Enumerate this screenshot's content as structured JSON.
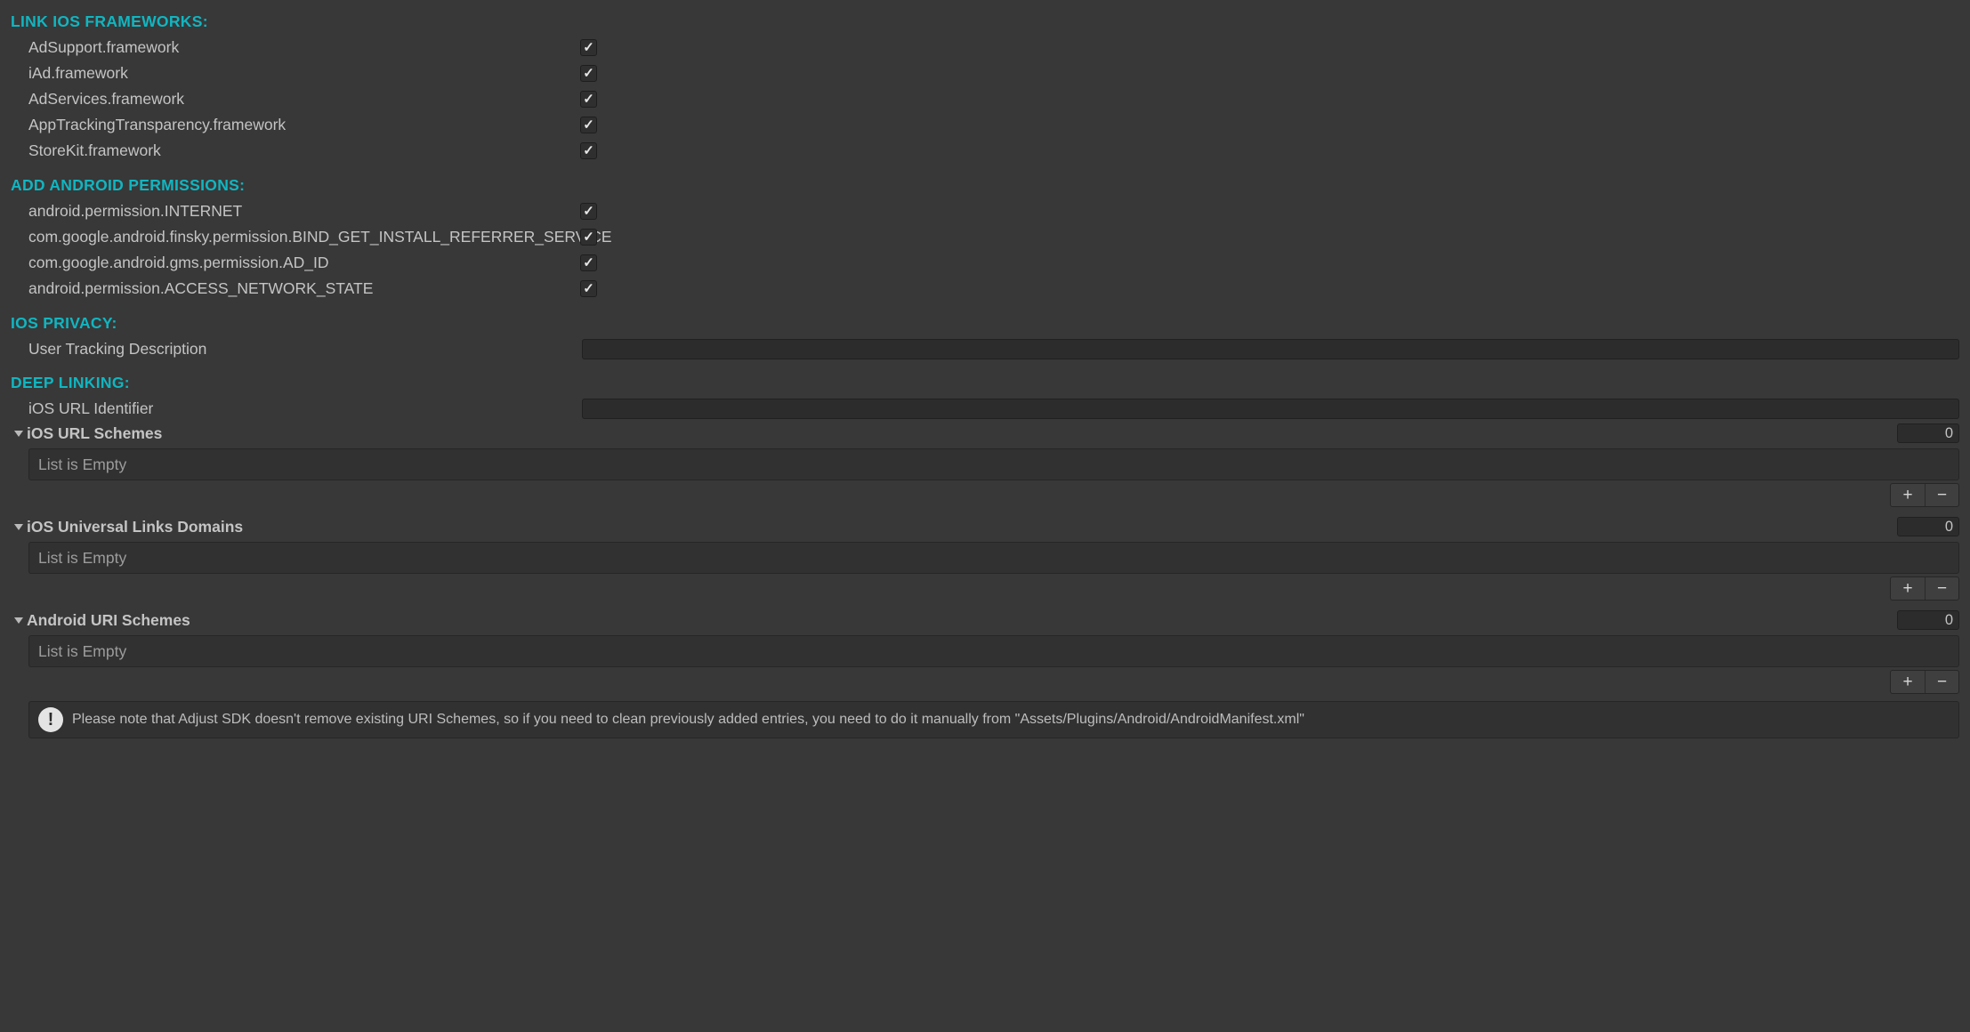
{
  "sections": {
    "ios_frameworks": {
      "header": "LINK IOS FRAMEWORKS:",
      "items": [
        {
          "label": "AdSupport.framework",
          "checked": true
        },
        {
          "label": "iAd.framework",
          "checked": true
        },
        {
          "label": "AdServices.framework",
          "checked": true
        },
        {
          "label": "AppTrackingTransparency.framework",
          "checked": true
        },
        {
          "label": "StoreKit.framework",
          "checked": true
        }
      ]
    },
    "android_permissions": {
      "header": "ADD ANDROID PERMISSIONS:",
      "items": [
        {
          "label": "android.permission.INTERNET",
          "checked": true
        },
        {
          "label": "com.google.android.finsky.permission.BIND_GET_INSTALL_REFERRER_SERVICE",
          "checked": true
        },
        {
          "label": "com.google.android.gms.permission.AD_ID",
          "checked": true
        },
        {
          "label": "android.permission.ACCESS_NETWORK_STATE",
          "checked": true
        }
      ]
    },
    "ios_privacy": {
      "header": "IOS PRIVACY:",
      "tracking_desc_label": "User Tracking Description",
      "tracking_desc_value": ""
    },
    "deep_linking": {
      "header": "DEEP LINKING:",
      "ios_url_identifier_label": "iOS URL Identifier",
      "ios_url_identifier_value": "",
      "lists": [
        {
          "label": "iOS URL Schemes",
          "count": "0",
          "empty_text": "List is Empty"
        },
        {
          "label": "iOS Universal Links Domains",
          "count": "0",
          "empty_text": "List is Empty"
        },
        {
          "label": "Android URI Schemes",
          "count": "0",
          "empty_text": "List is Empty"
        }
      ],
      "info_text": "Please note that Adjust SDK doesn't remove existing URI Schemes, so if you need to clean previously added entries, you need to do it manually from \"Assets/Plugins/Android/AndroidManifest.xml\""
    }
  },
  "glyphs": {
    "plus": "+",
    "minus": "−",
    "bang": "!"
  }
}
